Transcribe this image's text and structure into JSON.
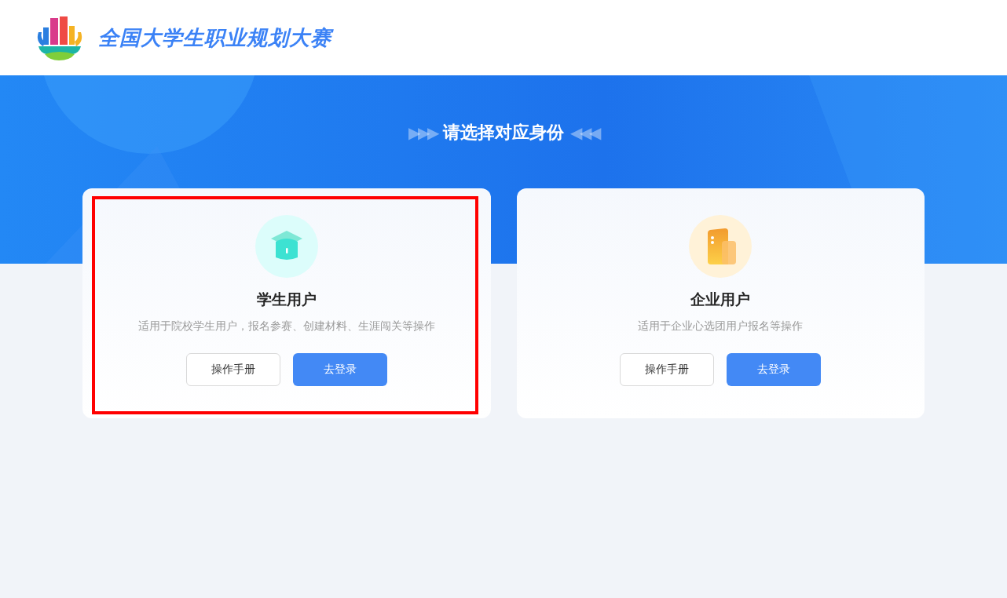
{
  "header": {
    "title": "全国大学生职业规划大赛"
  },
  "banner": {
    "heading": "请选择对应身份",
    "left_arrows": "▶▶▶",
    "right_arrows": "◀◀◀"
  },
  "cards": [
    {
      "kind": "student",
      "title": "学生用户",
      "description": "适用于院校学生用户，报名参赛、创建材料、生涯闯关等操作",
      "buttons": [
        "操作手册",
        "去登录"
      ],
      "highlighted": true
    },
    {
      "kind": "company",
      "title": "企业用户",
      "description": "适用于企业心选团用户报名等操作",
      "buttons": [
        "操作手册",
        "去登录"
      ],
      "highlighted": false
    }
  ]
}
